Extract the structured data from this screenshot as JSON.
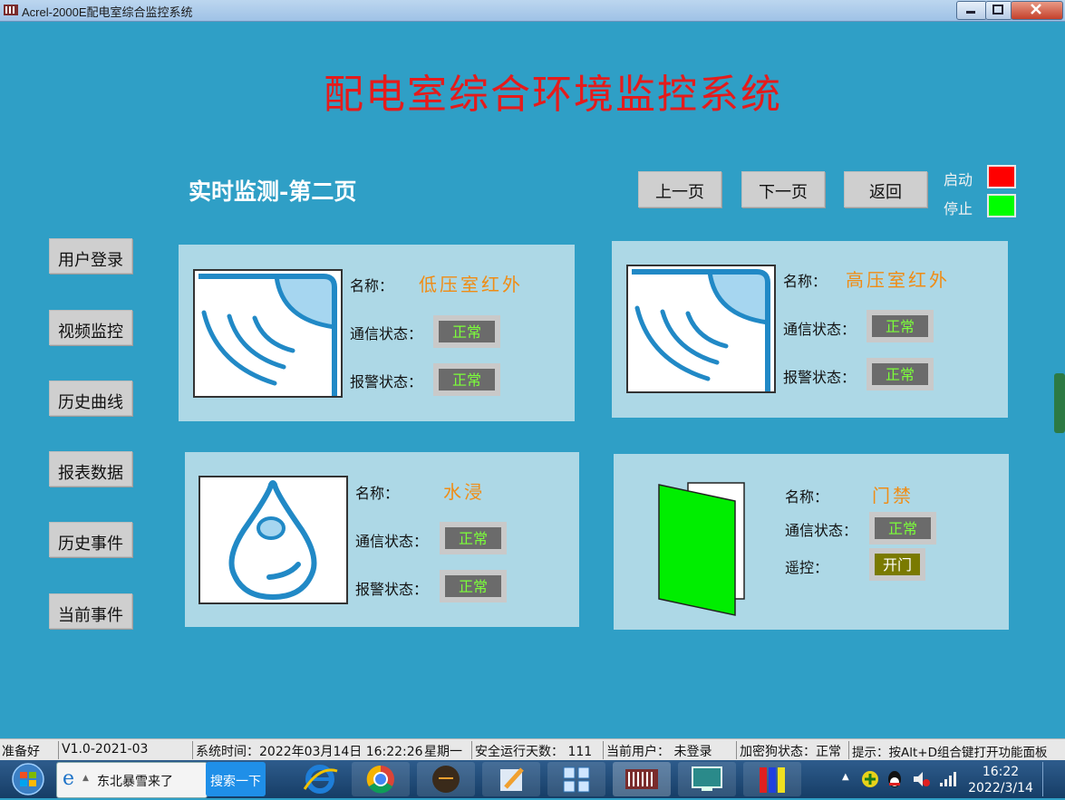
{
  "window": {
    "title": "Acrel-2000E配电室综合监控系统"
  },
  "header": {
    "title": "配电室综合环境监控系统",
    "page_heading": "实时监测-第二页"
  },
  "nav": {
    "prev": "上一页",
    "next": "下一页",
    "back": "返回"
  },
  "legend": {
    "start_label": "启动",
    "stop_label": "停止",
    "start_color": "#ff0000",
    "stop_color": "#00ff00"
  },
  "sidebar": {
    "items": [
      "用户登录",
      "视频监控",
      "历史曲线",
      "报表数据",
      "历史事件",
      "当前事件"
    ]
  },
  "labels": {
    "name": "名称：",
    "comm": "通信状态：",
    "alarm": "报警状态：",
    "remote": "遥控："
  },
  "panels": {
    "lv_infrared": {
      "name": "低压室红外",
      "comm": "正常",
      "alarm": "正常",
      "icon": "infrared-sensor-icon"
    },
    "hv_infrared": {
      "name": "高压室红外",
      "comm": "正常",
      "alarm": "正常",
      "icon": "infrared-sensor-icon"
    },
    "water": {
      "name": "水浸",
      "comm": "正常",
      "alarm": "正常",
      "icon": "water-drop-icon"
    },
    "door": {
      "name": "门禁",
      "comm": "正常",
      "remote_btn": "开门",
      "icon": "door-icon",
      "door_color": "#00ee00"
    }
  },
  "statusbar": {
    "ready": "准备好",
    "version": "V1.0-2021-03",
    "time": "系统时间：2022年03月14日  16:22:26",
    "weekday": "星期一",
    "safe_days": "安全运行天数：  111",
    "user": "当前用户：  未登录",
    "dongle": "加密狗状态：正常",
    "hint": "提示：按Alt+D组合键打开功能面板"
  },
  "taskbar": {
    "ie_text": "东北暴雪来了",
    "search_btn": "搜索一下",
    "clock_time": "16:22",
    "clock_date": "2022/3/14"
  }
}
